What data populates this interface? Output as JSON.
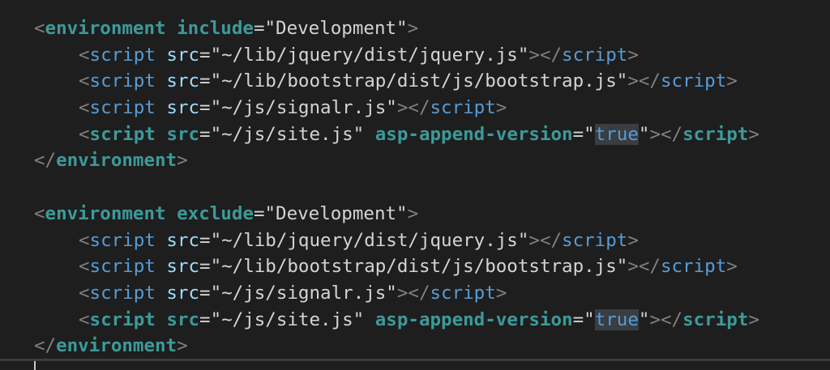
{
  "code": {
    "block1": {
      "open": {
        "tag": "environment",
        "attr": "include",
        "value": "\"Development\""
      },
      "scripts": [
        {
          "src": "\"~/lib/jquery/dist/jquery.js\""
        },
        {
          "src": "\"~/lib/bootstrap/dist/js/bootstrap.js\""
        },
        {
          "src": "\"~/js/signalr.js\""
        },
        {
          "src": "\"~/js/site.js\"",
          "extra_attr": "asp-append-version",
          "extra_value": "true"
        }
      ],
      "close": {
        "tag": "environment"
      }
    },
    "block2": {
      "open": {
        "tag": "environment",
        "attr": "exclude",
        "value": "\"Development\""
      },
      "scripts": [
        {
          "src": "\"~/lib/jquery/dist/jquery.js\""
        },
        {
          "src": "\"~/lib/bootstrap/dist/js/bootstrap.js\""
        },
        {
          "src": "\"~/js/signalr.js\""
        },
        {
          "src": "\"~/js/site.js\"",
          "extra_attr": "asp-append-version",
          "extra_value": "true"
        }
      ],
      "close": {
        "tag": "environment"
      }
    },
    "script_tag": "script",
    "src_attr": "src"
  }
}
